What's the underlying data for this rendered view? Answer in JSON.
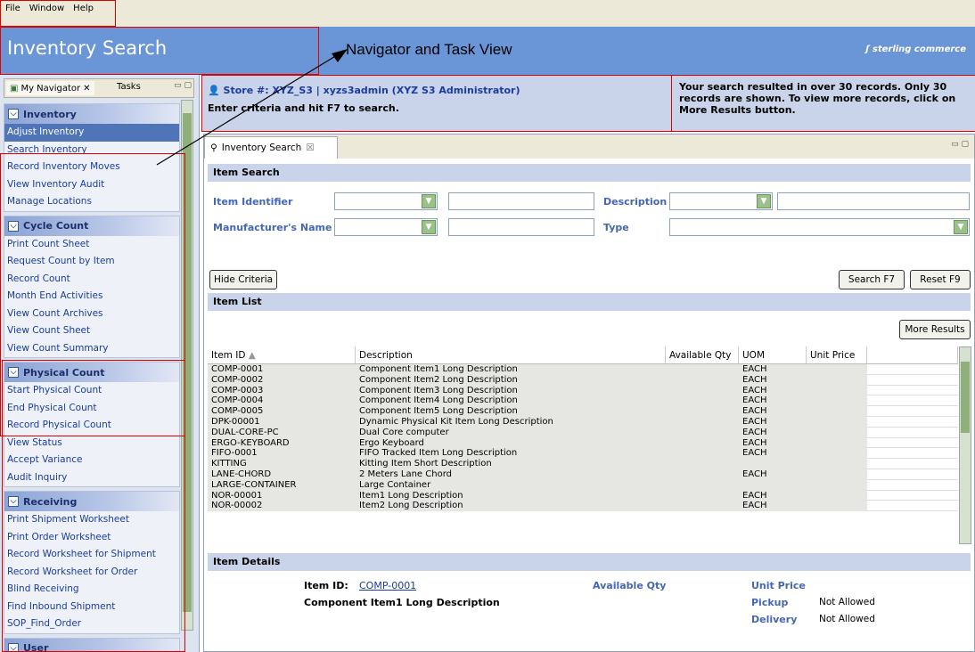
{
  "menubar": {
    "items": [
      "File",
      "Window",
      "Help"
    ]
  },
  "title": {
    "app": "Inventory Search",
    "logo": "sterling commerce",
    "callout": "Navigator and Task View"
  },
  "nav": {
    "tabs": {
      "navigator": "My Navigator",
      "tasks": "Tasks"
    },
    "sections": [
      {
        "title": "Inventory",
        "items": [
          "Adjust Inventory",
          "Search Inventory",
          "Record Inventory Moves",
          "View Inventory Audit",
          "Manage Locations"
        ]
      },
      {
        "title": "Cycle Count",
        "items": [
          "Print Count Sheet",
          "Request Count by Item",
          "Record Count",
          "Month End Activities",
          "View Count Archives",
          "View Count Sheet",
          "View Count Summary"
        ]
      },
      {
        "title": "Physical Count",
        "items": [
          "Start Physical Count",
          "End Physical Count",
          "Record Physical Count",
          "View Status",
          "Accept Variance",
          "Audit Inquiry"
        ]
      },
      {
        "title": "Receiving",
        "items": [
          "Print Shipment Worksheet",
          "Print Order Worksheet",
          "Record Worksheet for Shipment",
          "Record Worksheet for Order",
          "Blind Receiving",
          "Find Inbound Shipment",
          "SOP_Find_Order"
        ]
      },
      {
        "title": "User",
        "items": []
      }
    ]
  },
  "header": {
    "store": "Store #: XYZ_S3 | xyzs3admin (XYZ S3 Administrator)",
    "hint": "Enter criteria and hit F7 to search.",
    "message": "Your search resulted in over 30 records. Only 30 records are shown. To view more records, click on More Results button."
  },
  "editor": {
    "tab": "Inventory Search"
  },
  "search": {
    "title": "Item Search",
    "item_identifier": "Item Identifier",
    "description": "Description",
    "manufacturer": "Manufacturer's Name",
    "type": "Type",
    "hide_criteria": "Hide Criteria",
    "search_btn": "Search   F7",
    "reset_btn": "Reset   F9"
  },
  "list": {
    "title": "Item List",
    "more_results": "More Results",
    "columns": [
      "Item ID",
      "Description",
      "Available Qty",
      "UOM",
      "Unit Price"
    ],
    "rows": [
      [
        "COMP-0001",
        "Component Item1 Long Description",
        "",
        "EACH",
        ""
      ],
      [
        "COMP-0002",
        "Component Item2 Long Description",
        "",
        "EACH",
        ""
      ],
      [
        "COMP-0003",
        "Component Item3 Long Description",
        "",
        "EACH",
        ""
      ],
      [
        "COMP-0004",
        "Component Item4 Long Description",
        "",
        "EACH",
        ""
      ],
      [
        "COMP-0005",
        "Component Item5 Long Description",
        "",
        "EACH",
        ""
      ],
      [
        "DPK-00001",
        "Dynamic Physical Kit Item Long Description",
        "",
        "EACH",
        ""
      ],
      [
        "DUAL-CORE-PC",
        "Dual Core computer",
        "",
        "EACH",
        ""
      ],
      [
        "ERGO-KEYBOARD",
        "Ergo Keyboard",
        "",
        "EACH",
        ""
      ],
      [
        "FIFO-0001",
        "FIFO Tracked Item Long Description",
        "",
        "EACH",
        ""
      ],
      [
        "KITTING",
        "Kitting Item Short Description",
        "",
        "",
        ""
      ],
      [
        "LANE-CHORD",
        "2 Meters Lane Chord",
        "",
        "EACH",
        ""
      ],
      [
        "LARGE-CONTAINER",
        "Large Container",
        "",
        "",
        ""
      ],
      [
        "NOR-00001",
        "Item1 Long Description",
        "",
        "EACH",
        ""
      ],
      [
        "NOR-00002",
        "Item2 Long Description",
        "",
        "EACH",
        ""
      ]
    ]
  },
  "details": {
    "title": "Item Details",
    "item_id_label": "Item ID:",
    "item_id": "COMP-0001",
    "item_desc": "Component Item1 Long Description",
    "available_qty": "Available Qty",
    "unit_price": "Unit Price",
    "pickup": "Pickup",
    "pickup_val": "Not Allowed",
    "delivery": "Delivery",
    "delivery_val": "Not Allowed"
  }
}
